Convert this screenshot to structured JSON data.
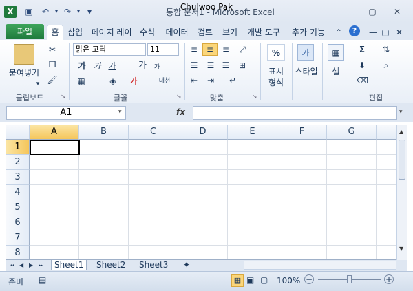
{
  "window": {
    "title": "통합 문서1 - Microsoft Excel",
    "overlay_name": "Chulwoo Pak",
    "minimize": "—",
    "restore": "▢",
    "close": "✕"
  },
  "qat": {
    "excel_icon": "X",
    "save": "💾",
    "undo": "↶",
    "redo": "↷",
    "customize": "▾"
  },
  "tabs": {
    "file": "파일",
    "items": [
      "홈",
      "삽입",
      "페이지 레이",
      "수식",
      "데이터",
      "검토",
      "보기",
      "개발 도구",
      "추가 기능"
    ],
    "active_index": 0,
    "collapse": "⌃",
    "help": "?",
    "doc_min": "—",
    "doc_restore": "▢",
    "doc_close": "✕"
  },
  "ribbon": {
    "clipboard": {
      "label": "클립보드",
      "paste_label": "붙여넣기"
    },
    "font": {
      "label": "글꼴",
      "font_name": "맑은 고딕",
      "font_size": "11",
      "bold": "가",
      "italic": "가",
      "underline": "가",
      "grow": "가",
      "shrink": "가",
      "font_color": "가",
      "phonetic": "내천"
    },
    "alignment": {
      "label": "맞춤"
    },
    "number": {
      "label": "표시 형식",
      "percent": "%",
      "line1": "표시",
      "line2": "형식"
    },
    "styles": {
      "label": "스타일",
      "glyph": "가"
    },
    "cells": {
      "label": "셀"
    },
    "editing": {
      "label": "편집",
      "sum": "Σ"
    }
  },
  "formula_bar": {
    "name_box": "A1",
    "fx": "fx",
    "value": ""
  },
  "grid": {
    "columns": [
      "A",
      "B",
      "C",
      "D",
      "E",
      "F",
      "G"
    ],
    "rows": [
      "1",
      "2",
      "3",
      "4",
      "5",
      "6",
      "7",
      "8"
    ],
    "selected_col": "A",
    "selected_row": "1"
  },
  "sheets": {
    "tabs": [
      "Sheet1",
      "Sheet2",
      "Sheet3"
    ],
    "active": "Sheet1"
  },
  "status": {
    "ready": "준비",
    "zoom": "100%",
    "zoom_out": "−",
    "zoom_in": "+"
  }
}
